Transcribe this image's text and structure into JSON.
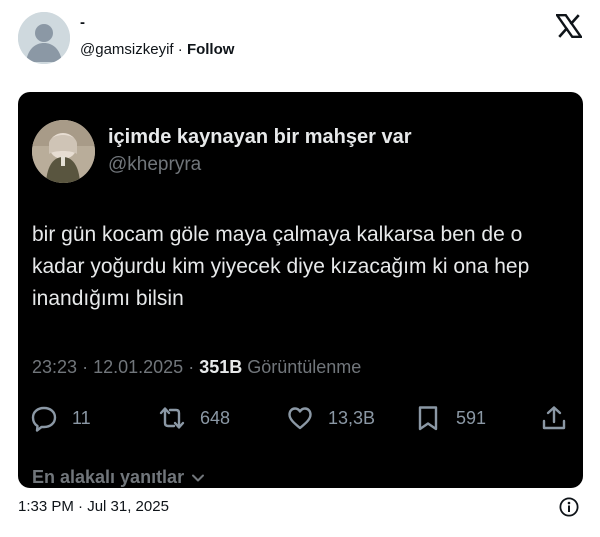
{
  "author": {
    "display_name": "-",
    "handle": "@gamsizkeyif",
    "separator": "·",
    "follow_label": "Follow"
  },
  "quoted_tweet": {
    "display_name": "içimde kaynayan bir mahşer var",
    "handle": "@khepryra",
    "text": "bir gün kocam göle maya çalmaya kalkarsa ben de o kadar yoğurdu kim yiyecek diye kızacağım ki ona hep inandığımı bilsin",
    "time": "23:23",
    "date": "12.01.2025",
    "views_count": "351B",
    "views_label": "Görüntülenme",
    "meta_separator": "·",
    "replies": "11",
    "retweets": "648",
    "likes": "13,3B",
    "bookmarks": "591",
    "relevant_replies_label": "En alakalı yanıtlar"
  },
  "footer": {
    "timestamp": "1:33 PM · Jul 31, 2025"
  },
  "icons": [
    "default-avatar-icon",
    "x-logo-icon",
    "reply-icon",
    "retweet-icon",
    "like-icon",
    "bookmark-icon",
    "share-icon",
    "chevron-down-icon",
    "info-icon"
  ],
  "colors": {
    "dark_card": "#000000",
    "dark_text": "#e7e9ea",
    "muted_text": "#71767b",
    "action_icon": "#8b98a5"
  }
}
